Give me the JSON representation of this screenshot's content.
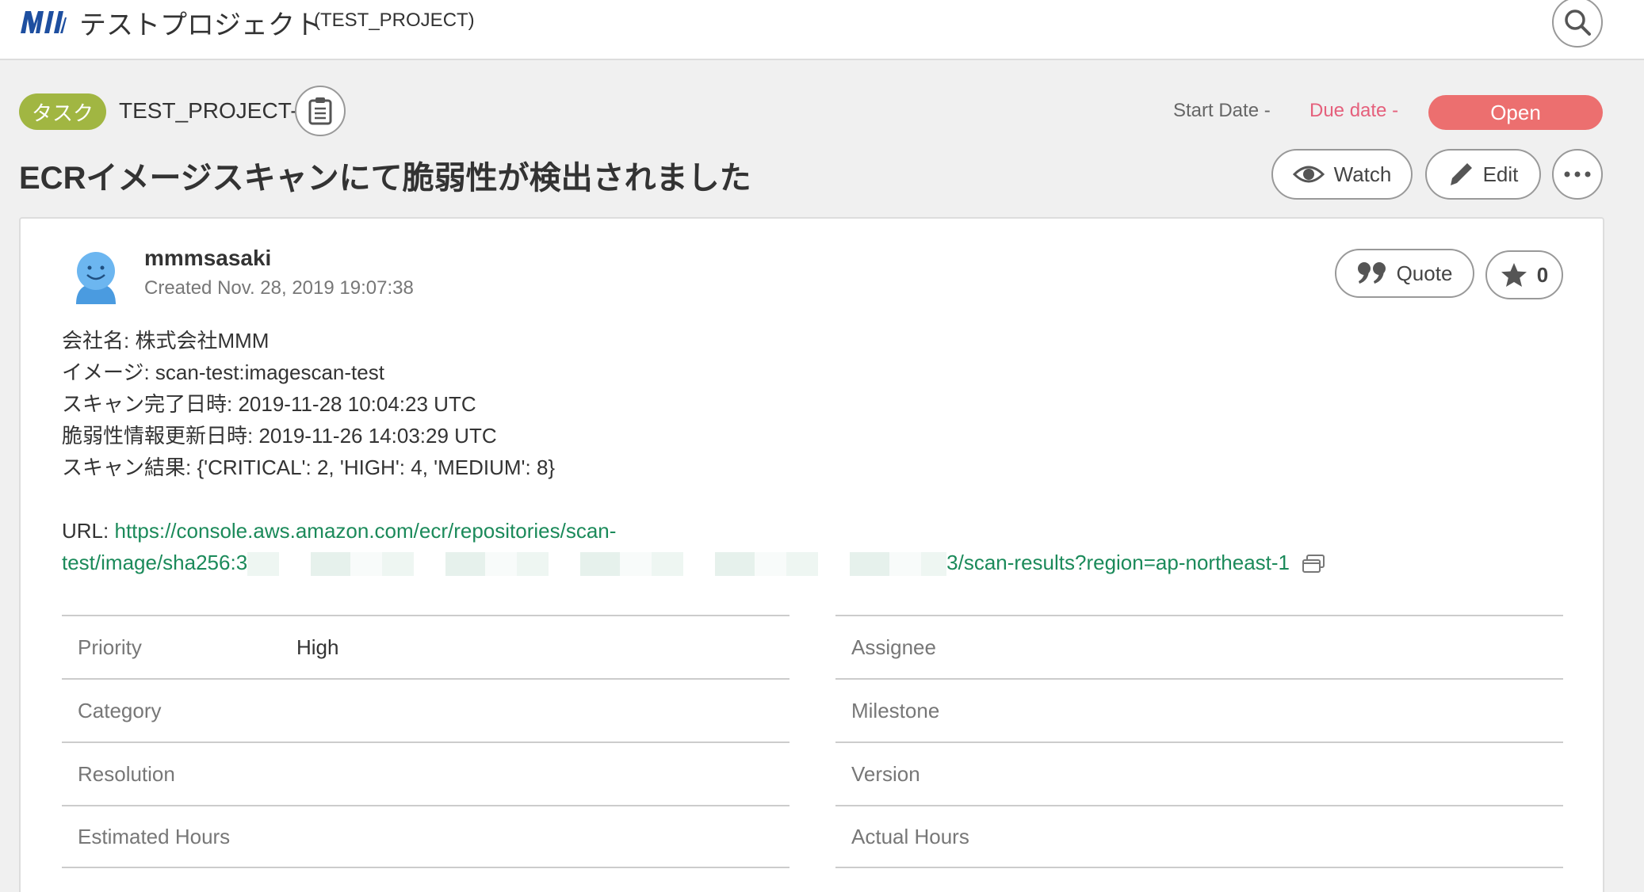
{
  "header": {
    "project_name": "テストプロジェクト",
    "project_key": "(TEST_PROJECT)",
    "icons": [
      "logo",
      "search-icon"
    ]
  },
  "issue": {
    "type": "タスク",
    "key": "TEST_PROJECT-19",
    "start_date_label": "Start Date",
    "start_date_value": "-",
    "due_date_label": "Due date",
    "due_date_value": "-",
    "status": "Open",
    "title": "ECRイメージスキャンにて脆弱性が検出されました",
    "watch_label": "Watch",
    "edit_label": "Edit",
    "colors": {
      "type_badge": "#a1b642",
      "status": "#ec6f6f",
      "due_date": "#e5607c",
      "link": "#1b8a5a"
    }
  },
  "comment": {
    "author": "mmmsasaki",
    "created_label": "Created",
    "created_at": "Nov. 28, 2019 19:07:38",
    "quote_label": "Quote",
    "star_count": "0",
    "description_lines": [
      "会社名: 株式会社MMM",
      "イメージ: scan-test:imagescan-test",
      "スキャン完了日時: 2019-11-28 10:04:23 UTC",
      "脆弱性情報更新日時: 2019-11-26 14:03:29 UTC",
      "スキャン結果: {'CRITICAL': 2, 'HIGH': 4, 'MEDIUM': 8}"
    ],
    "url_label": "URL:",
    "url_line1": "https://console.aws.amazon.com/ecr/repositories/scan-",
    "url_line2_start": "test/image/sha256:3",
    "url_line2_end": "3/scan-results?region=ap-northeast-1"
  },
  "properties_left": [
    {
      "label": "Priority",
      "value": "High"
    },
    {
      "label": "Category",
      "value": ""
    },
    {
      "label": "Resolution",
      "value": ""
    },
    {
      "label": "Estimated Hours",
      "value": ""
    }
  ],
  "properties_right": [
    {
      "label": "Assignee",
      "value": ""
    },
    {
      "label": "Milestone",
      "value": ""
    },
    {
      "label": "Version",
      "value": ""
    },
    {
      "label": "Actual Hours",
      "value": ""
    }
  ]
}
